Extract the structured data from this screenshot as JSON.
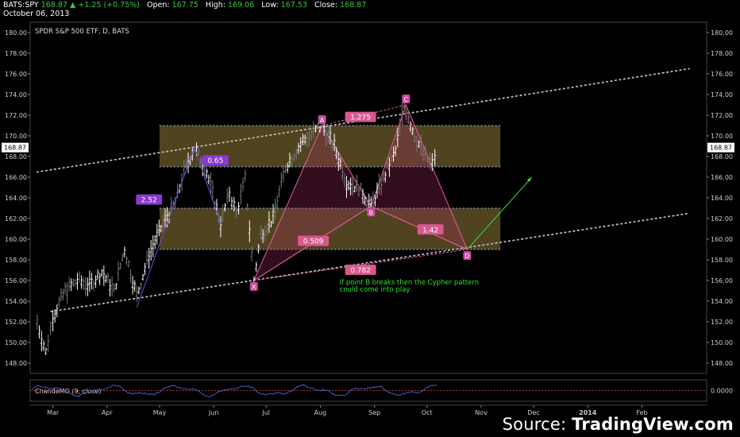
{
  "header": {
    "symbol": "BATS:SPY",
    "last": "168.87",
    "change": "▲ +1.25 (+0.75%)",
    "open_label": "Open:",
    "open": "167.75",
    "high_label": "High:",
    "high": "169.06",
    "low_label": "Low:",
    "low": "167.53",
    "close_label": "Close:",
    "close": "168.87",
    "date": "October 06, 2013"
  },
  "source": {
    "prefix": "Source: ",
    "brand": "TradingView.com"
  },
  "colors": {
    "background": "#000000",
    "axis_text": "#cccccc",
    "zone_fill": "#6b5a2a",
    "pattern_pink": "#e0609a",
    "label_purple": "#8a3ad0",
    "note_green": "#33dd33",
    "cmo_line": "#3a64c8",
    "up_bar": "#ffffff",
    "trend_dots": "#bbbbbb"
  },
  "chart_data": [
    {
      "type": "ohlc",
      "title": "SPDR S&P 500 ETF, D, BATS",
      "ylim": [
        147,
        181
      ],
      "y_ticks": [
        148,
        150,
        152,
        154,
        156,
        158,
        160,
        162,
        164,
        166,
        168,
        170,
        172,
        174,
        176,
        178,
        180
      ],
      "y_tick_labels": [
        "148.00",
        "150.00",
        "152.00",
        "154.00",
        "156.00",
        "158.00",
        "160.00",
        "162.00",
        "164.00",
        "166.00",
        "168.00",
        "170.00",
        "172.00",
        "174.00",
        "176.00",
        "178.00",
        "180.00"
      ],
      "x_ticks": [
        "Mar",
        "Apr",
        "May",
        "Jun",
        "Jul",
        "Aug",
        "Sep",
        "Oct",
        "Nov",
        "Dec",
        "2014",
        "Feb"
      ],
      "last_price_label": "168.87",
      "grid": false,
      "price_path": [
        [
          "2013-02-20",
          152.0
        ],
        [
          "2013-02-25",
          149.0
        ],
        [
          "2013-03-01",
          152.5
        ],
        [
          "2013-03-08",
          155.0
        ],
        [
          "2013-03-15",
          156.0
        ],
        [
          "2013-03-22",
          155.5
        ],
        [
          "2013-03-29",
          156.8
        ],
        [
          "2013-04-05",
          155.0
        ],
        [
          "2013-04-11",
          159.0
        ],
        [
          "2013-04-18",
          154.5
        ],
        [
          "2013-04-25",
          158.5
        ],
        [
          "2013-05-03",
          161.5
        ],
        [
          "2013-05-10",
          163.5
        ],
        [
          "2013-05-15",
          166.5
        ],
        [
          "2013-05-21",
          168.9
        ],
        [
          "2013-05-28",
          166.5
        ],
        [
          "2013-06-05",
          161.5
        ],
        [
          "2013-06-10",
          164.5
        ],
        [
          "2013-06-14",
          162.5
        ],
        [
          "2013-06-19",
          165.8
        ],
        [
          "2013-06-24",
          156.0
        ],
        [
          "2013-06-28",
          160.5
        ],
        [
          "2013-07-05",
          162.0
        ],
        [
          "2013-07-12",
          167.0
        ],
        [
          "2013-07-22",
          169.5
        ],
        [
          "2013-08-02",
          171.0
        ],
        [
          "2013-08-09",
          169.0
        ],
        [
          "2013-08-16",
          165.5
        ],
        [
          "2013-08-23",
          165.0
        ],
        [
          "2013-08-30",
          163.2
        ],
        [
          "2013-09-06",
          165.8
        ],
        [
          "2013-09-13",
          168.5
        ],
        [
          "2013-09-18",
          173.0
        ],
        [
          "2013-09-24",
          170.0
        ],
        [
          "2013-09-30",
          168.0
        ],
        [
          "2013-10-04",
          167.2
        ],
        [
          "2013-10-07",
          168.87
        ]
      ],
      "zones": [
        {
          "from": "2013-05-01",
          "to": "2013-11-12",
          "low": 167.0,
          "high": 171.0
        },
        {
          "from": "2013-05-01",
          "to": "2013-11-12",
          "low": 159.0,
          "high": 163.0
        }
      ],
      "trendlines": [
        {
          "p1": [
            "2013-02-20",
            166.5
          ],
          "p2": [
            "2014-02-28",
            176.5
          ]
        },
        {
          "p1": [
            "2013-02-28",
            153.0
          ],
          "p2": [
            "2014-02-28",
            162.5
          ]
        }
      ],
      "pattern_points": [
        {
          "label": "X",
          "date": "2013-06-24",
          "price": 156.0
        },
        {
          "label": "A",
          "date": "2013-08-02",
          "price": 171.0
        },
        {
          "label": "B",
          "date": "2013-08-30",
          "price": 163.2
        },
        {
          "label": "C",
          "date": "2013-09-19",
          "price": 173.0
        },
        {
          "label": "D",
          "date": "2013-10-24",
          "price": 159.0
        }
      ],
      "ratio_labels": [
        {
          "text": "1.275",
          "date": "2013-08-24",
          "price": 171.8,
          "color": "pink"
        },
        {
          "text": "0.509",
          "date": "2013-07-28",
          "price": 159.8,
          "color": "pink"
        },
        {
          "text": "1.42",
          "date": "2013-10-03",
          "price": 160.9,
          "color": "pink"
        },
        {
          "text": "0.782",
          "date": "2013-08-24",
          "price": 157.0,
          "color": "pink"
        },
        {
          "text": "2.52",
          "date": "2013-04-25",
          "price": 163.8,
          "color": "purple"
        },
        {
          "text": "0.65",
          "date": "2013-06-02",
          "price": 167.6,
          "color": "purple"
        }
      ],
      "annotation": [
        "If point B breaks then the Cypher pattern",
        "could come into play"
      ],
      "projection": {
        "from": [
          "2013-10-24",
          159.0
        ],
        "to": [
          "2013-11-30",
          166.0
        ]
      }
    },
    {
      "type": "line",
      "title": "ChandeMO (9, close)",
      "ylim": [
        -60,
        60
      ],
      "y_tick_labels": [
        "0.0000"
      ],
      "zero_line": true
    }
  ]
}
